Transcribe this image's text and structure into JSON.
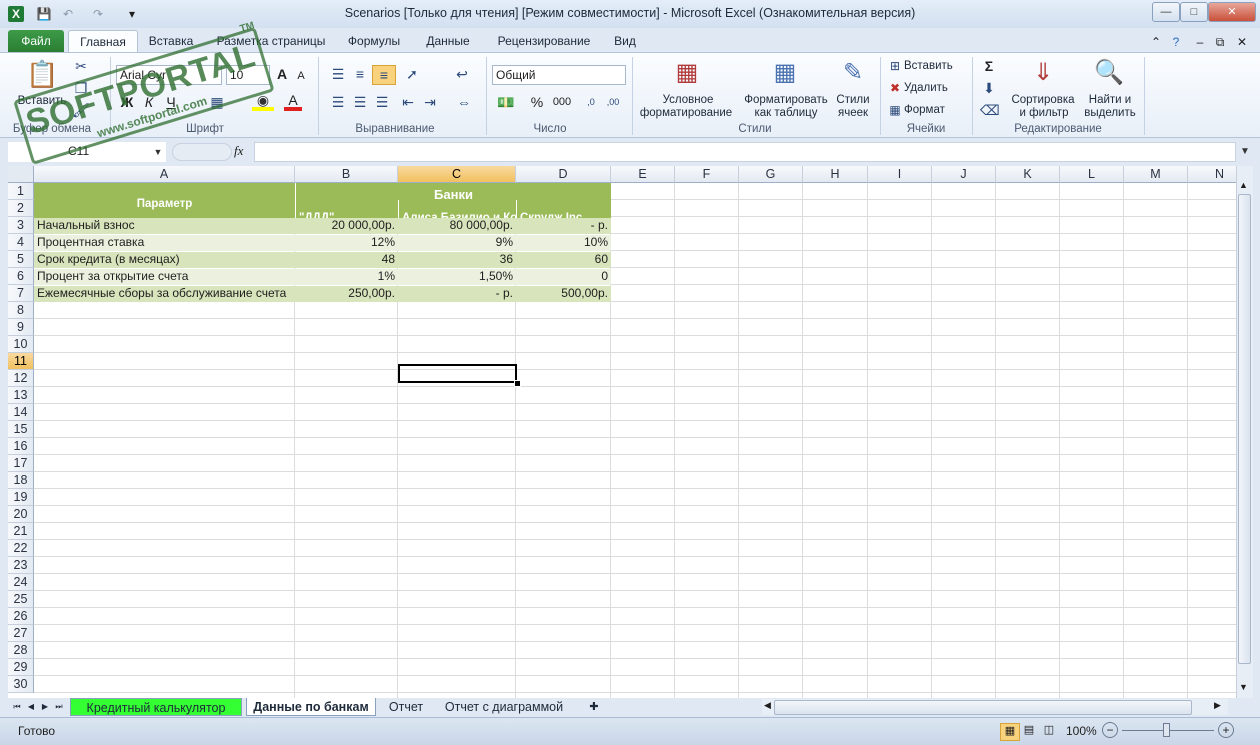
{
  "window": {
    "title": "Scenarios  [Только для чтения]  [Режим совместимости]  -  Microsoft Excel (Ознакомительная версия)"
  },
  "tabs": [
    "Файл",
    "Главная",
    "Вставка",
    "Разметка страницы",
    "Формулы",
    "Данные",
    "Рецензирование",
    "Вид"
  ],
  "ribbon": {
    "clipboard": {
      "paste": "Вставить",
      "label": "Буфер обмена"
    },
    "font": {
      "name": "Arial Cyr",
      "size": "10",
      "bold": "Ж",
      "italic": "К",
      "underline": "Ч",
      "label": "Шрифт"
    },
    "alignment": {
      "label": "Выравнивание"
    },
    "number": {
      "format": "Общий",
      "percent": "%",
      "thousands": "000",
      "label": "Число"
    },
    "styles": {
      "cond1": "Условное",
      "cond2": "форматирование",
      "table1": "Форматировать",
      "table2": "как таблицу",
      "cell1": "Стили",
      "cell2": "ячеек",
      "label": "Стили"
    },
    "cells": {
      "insert": "Вставить",
      "delete": "Удалить",
      "format": "Формат",
      "label": "Ячейки"
    },
    "editing": {
      "sort1": "Сортировка",
      "sort2": "и фильтр",
      "find1": "Найти и",
      "find2": "выделить",
      "label": "Редактирование"
    }
  },
  "formula_bar": {
    "name_box": "C11",
    "fx": "fx",
    "value": ""
  },
  "columns": [
    "A",
    "B",
    "C",
    "D",
    "E",
    "F",
    "G",
    "H",
    "I",
    "J",
    "K",
    "L",
    "M",
    "N"
  ],
  "rows": [
    "1",
    "2",
    "3",
    "4",
    "5",
    "6",
    "7",
    "8",
    "9",
    "10",
    "11",
    "12",
    "13",
    "14",
    "15",
    "16",
    "17",
    "18",
    "19",
    "20",
    "21",
    "22",
    "23",
    "24",
    "25",
    "26",
    "27",
    "28",
    "29",
    "30"
  ],
  "sheet": {
    "header_param": "Параметр",
    "header_banks": "Банки",
    "banks": [
      "\"ДДД\"",
      "Алиса,Базилио и Ко",
      "Скрудж Inc"
    ],
    "data": [
      {
        "label": "Начальный взнос",
        "b": "20 000,00р.",
        "c": "80 000,00р.",
        "d": "-     р."
      },
      {
        "label": "Процентная ставка",
        "b": "12%",
        "c": "9%",
        "d": "10%"
      },
      {
        "label": "Срок кредита (в месяцах)",
        "b": "48",
        "c": "36",
        "d": "60"
      },
      {
        "label": "Процент за открытие счета",
        "b": "1%",
        "c": "1,50%",
        "d": "0"
      },
      {
        "label": "Ежемесячные сборы за обслуживание счета",
        "b": "250,00р.",
        "c": "-     р.",
        "d": "500,00р."
      }
    ]
  },
  "sheet_tabs": [
    "Кредитный калькулятор",
    "Данные по банкам",
    "Отчет",
    "Отчет с диаграммой"
  ],
  "status": {
    "ready": "Готово",
    "zoom": "100%"
  },
  "watermark": {
    "brand": "SOFTPORTAL",
    "url": "www.softportal.com",
    "tm": "TM"
  },
  "colors": {
    "header_green": "#9bbb59",
    "row_light": "#ebf1de",
    "row_mid": "#d8e4bc",
    "file_tab": "#2f8a3a",
    "active_sheet_tab": "#33ff33"
  }
}
